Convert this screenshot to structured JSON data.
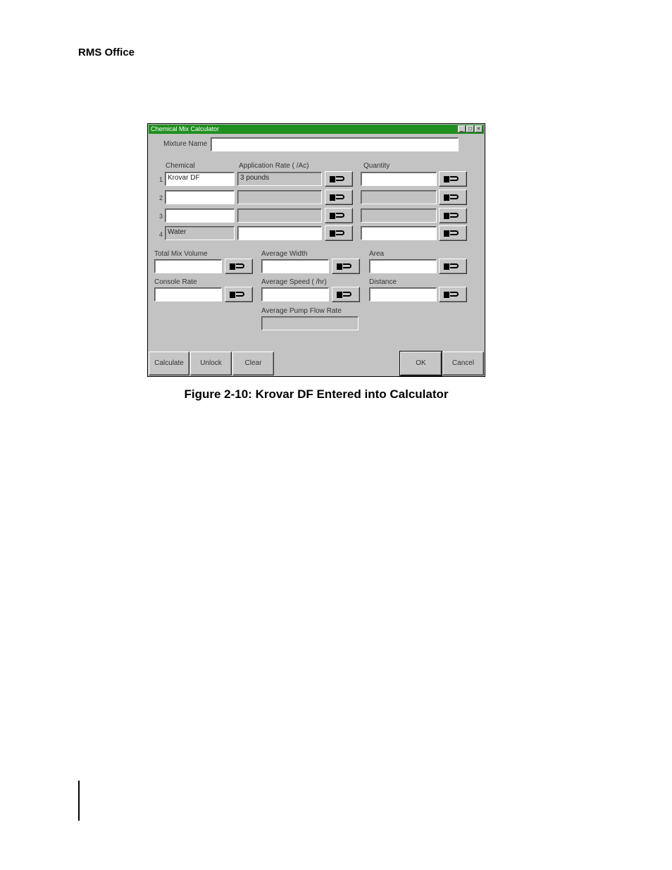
{
  "document": {
    "header": "RMS Office",
    "caption": "Figure 2-10: Krovar DF Entered into Calculator"
  },
  "dialog": {
    "title": "Chemical Mix Calculator",
    "titlebar_buttons": {
      "minimize": "_",
      "maximize": "□",
      "close": "×"
    },
    "mixture_name": {
      "label": "Mixture Name",
      "value": ""
    },
    "columns": {
      "chemical": "Chemical",
      "application_rate": "Application Rate ( /Ac)",
      "quantity": "Quantity"
    },
    "rows": [
      {
        "num": "1",
        "chemical": "Krovar DF",
        "application_rate": "3 pounds",
        "quantity": ""
      },
      {
        "num": "2",
        "chemical": "",
        "application_rate": "",
        "quantity": ""
      },
      {
        "num": "3",
        "chemical": "",
        "application_rate": "",
        "quantity": ""
      },
      {
        "num": "4",
        "chemical": "Water",
        "application_rate": "",
        "quantity": ""
      }
    ],
    "fields": {
      "total_mix_volume": {
        "label": "Total Mix Volume",
        "value": ""
      },
      "average_width": {
        "label": "Average Width",
        "value": ""
      },
      "area": {
        "label": "Area",
        "value": ""
      },
      "console_rate": {
        "label": "Console Rate",
        "value": ""
      },
      "average_speed": {
        "label": "Average Speed ( /hr)",
        "value": ""
      },
      "distance": {
        "label": "Distance",
        "value": ""
      },
      "average_pump_flow_rate": {
        "label": "Average Pump Flow Rate",
        "value": ""
      }
    },
    "buttons": {
      "calculate": "Calculate",
      "unlock": "Unlock",
      "clear": "Clear",
      "ok": "OK",
      "cancel": "Cancel"
    }
  }
}
